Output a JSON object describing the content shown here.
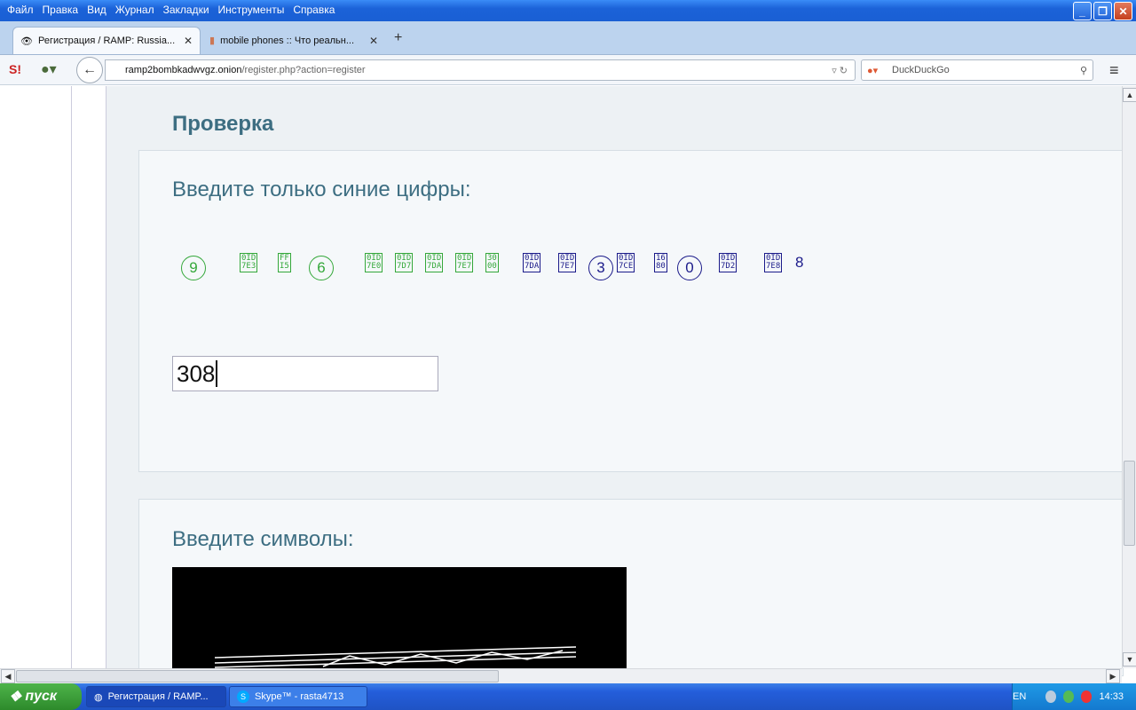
{
  "menu": [
    "Файл",
    "Правка",
    "Вид",
    "Журнал",
    "Закладки",
    "Инструменты",
    "Справка"
  ],
  "tabs": [
    {
      "label": "Регистрация / RAMP: Russia...",
      "active": true
    },
    {
      "label": "mobile phones :: Что реальн...",
      "active": false
    }
  ],
  "nav": {
    "url_domain": "ramp2bombkadwvgz.onion",
    "url_path": "/register.php?action=register",
    "search_placeholder": "DuckDuckGo"
  },
  "page": {
    "section_title": "Проверка",
    "captcha_label": "Введите только синие цифры:",
    "captcha_glyphs": [
      {
        "type": "circle",
        "text": "9",
        "color": "green"
      },
      {
        "type": "box",
        "text": "0ID\n7E3",
        "color": "green"
      },
      {
        "type": "box",
        "text": "FF\nI5",
        "color": "green"
      },
      {
        "type": "circle",
        "text": "6",
        "color": "green"
      },
      {
        "type": "box",
        "text": "0ID\n7E0",
        "color": "green"
      },
      {
        "type": "box",
        "text": "0ID\n7D7",
        "color": "green"
      },
      {
        "type": "box",
        "text": "0ID\n7DA",
        "color": "green"
      },
      {
        "type": "box",
        "text": "0ID\n7E7",
        "color": "green"
      },
      {
        "type": "box",
        "text": "30\n00",
        "color": "green"
      },
      {
        "type": "box",
        "text": "0ID\n7DA",
        "color": "blue"
      },
      {
        "type": "box",
        "text": "0ID\n7E7",
        "color": "blue"
      },
      {
        "type": "circle",
        "text": "3",
        "color": "blue"
      },
      {
        "type": "box",
        "text": "0ID\n7CE",
        "color": "blue"
      },
      {
        "type": "box",
        "text": "16\n80",
        "color": "blue"
      },
      {
        "type": "circle",
        "text": "0",
        "color": "blue"
      },
      {
        "type": "box",
        "text": "0ID\n7D2",
        "color": "blue"
      },
      {
        "type": "box",
        "text": "0ID\n7E8",
        "color": "blue"
      },
      {
        "type": "plain",
        "text": "8",
        "color": "blue"
      }
    ],
    "captcha_input_value": "308",
    "symbols_label": "Введите символы:"
  },
  "taskbar": {
    "start_label": "пуск",
    "buttons": [
      "Регистрация / RAMP...",
      "Skype™ - rasta4713"
    ],
    "lang": "EN",
    "clock": "14:33"
  },
  "colors": {
    "heading": "#3d6e82",
    "captcha_green": "#34a83a",
    "captcha_blue": "#1b1b8a"
  }
}
